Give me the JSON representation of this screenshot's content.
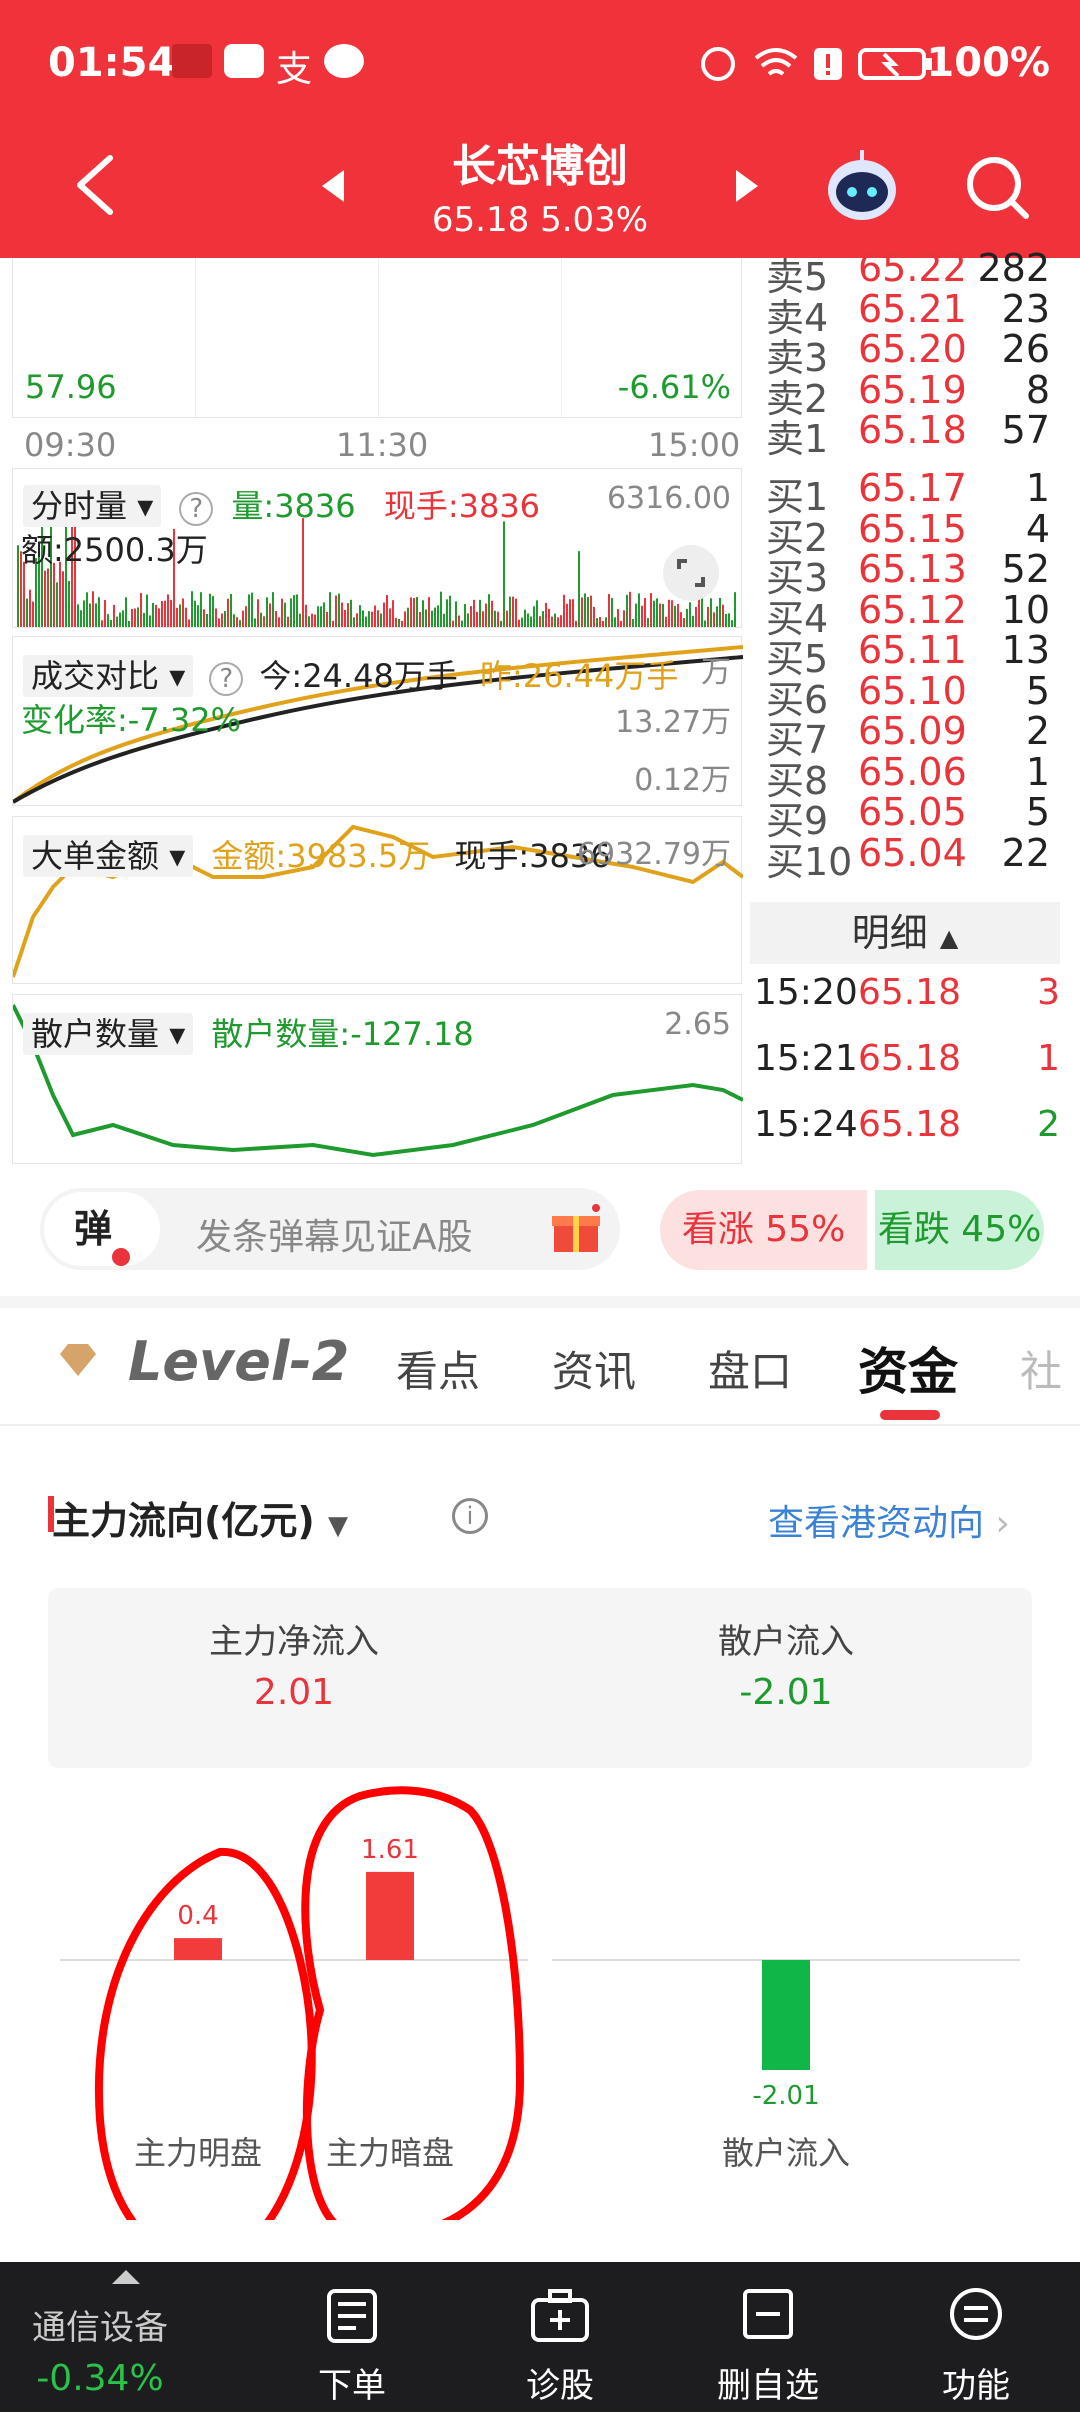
{
  "status": {
    "time": "01:54",
    "battery": "100%"
  },
  "header": {
    "stock_name": "长芯博创",
    "price_change": "65.18 5.03%"
  },
  "chart_labels": {
    "low_price": "57.96",
    "low_pct": "-6.61%",
    "time_start": "09:30",
    "time_mid": "11:30",
    "time_end": "15:00"
  },
  "indicators": {
    "volume": {
      "name": "分时量",
      "qty": "量:3836",
      "hand": "现手:3836",
      "max": "6316.00",
      "amount": "额:2500.3万"
    },
    "compare": {
      "name": "成交对比",
      "today": "今:24.48万手",
      "yesterday": "昨:26.44万手",
      "top_unit": "万",
      "rate": "变化率:-7.32%",
      "mid": "13.27万",
      "low": "0.12万"
    },
    "big_order": {
      "name": "大单金额",
      "amount": "金额:3983.5万",
      "hand": "现手:3836",
      "max": "6932.79万"
    },
    "retail": {
      "name": "散户数量",
      "count": "散户数量:-127.18",
      "max": "2.65"
    }
  },
  "orderbook": {
    "asks": [
      {
        "label": "卖5",
        "price": "65.22",
        "vol": "282"
      },
      {
        "label": "卖4",
        "price": "65.21",
        "vol": "23"
      },
      {
        "label": "卖3",
        "price": "65.20",
        "vol": "26"
      },
      {
        "label": "卖2",
        "price": "65.19",
        "vol": "8"
      },
      {
        "label": "卖1",
        "price": "65.18",
        "vol": "57"
      }
    ],
    "bids": [
      {
        "label": "买1",
        "price": "65.17",
        "vol": "1"
      },
      {
        "label": "买2",
        "price": "65.15",
        "vol": "4"
      },
      {
        "label": "买3",
        "price": "65.13",
        "vol": "52"
      },
      {
        "label": "买4",
        "price": "65.12",
        "vol": "10"
      },
      {
        "label": "买5",
        "price": "65.11",
        "vol": "13"
      },
      {
        "label": "买6",
        "price": "65.10",
        "vol": "5"
      },
      {
        "label": "买7",
        "price": "65.09",
        "vol": "2"
      },
      {
        "label": "买8",
        "price": "65.06",
        "vol": "1"
      },
      {
        "label": "买9",
        "price": "65.05",
        "vol": "5"
      },
      {
        "label": "买10",
        "price": "65.04",
        "vol": "22"
      }
    ]
  },
  "ticks": {
    "title": "明细",
    "rows": [
      {
        "time": "15:20",
        "price": "65.18",
        "vol": "3",
        "dir": "up"
      },
      {
        "time": "15:21",
        "price": "65.18",
        "vol": "1",
        "dir": "up"
      },
      {
        "time": "15:24",
        "price": "65.18",
        "vol": "2",
        "dir": "down"
      }
    ]
  },
  "danmu": {
    "icon_label": "弹",
    "placeholder": "发条弹幕见证A股",
    "bull": "看涨 55%",
    "bear": "看跌 45%",
    "bull_pct": 55
  },
  "tabs": {
    "level2": "Level-2",
    "items": [
      "看点",
      "资讯",
      "盘口",
      "资金",
      "社"
    ],
    "active": "资金"
  },
  "fund": {
    "title": "主力流向(亿元)",
    "hk_link": "查看港资动向",
    "net_label": "主力净流入",
    "net_value": "2.01",
    "retail_label": "散户流入",
    "retail_value": "-2.01"
  },
  "chart_data": {
    "type": "bar",
    "categories": [
      "主力明盘",
      "主力暗盘",
      "散户流入"
    ],
    "values": [
      0.4,
      1.61,
      -2.01
    ],
    "value_labels": [
      "0.4",
      "1.61",
      "-2.01"
    ],
    "title": "",
    "xlabel": "",
    "ylabel": ""
  },
  "bottom_nav": {
    "sector_name": "通信设备",
    "sector_change": "-0.34%",
    "order": "下单",
    "diagnose": "诊股",
    "remove_fav": "删自选",
    "functions": "功能"
  }
}
